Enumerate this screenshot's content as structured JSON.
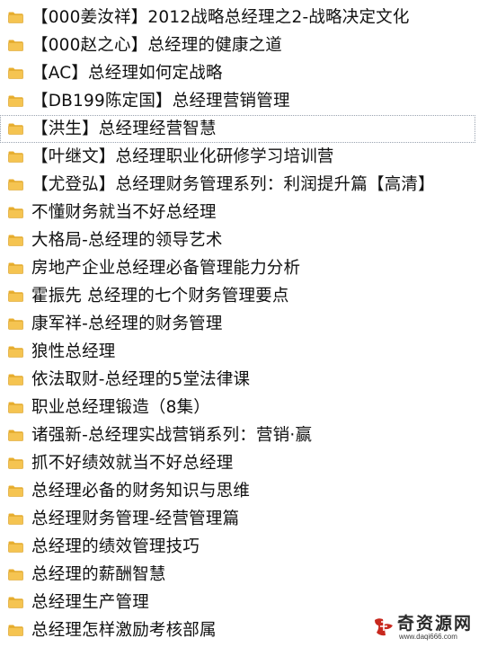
{
  "folders": [
    {
      "label": "【000姜汝祥】2012战略总经理之2-战略决定文化",
      "selected": false
    },
    {
      "label": "【000赵之心】总经理的健康之道",
      "selected": false
    },
    {
      "label": "【AC】总经理如何定战略",
      "selected": false
    },
    {
      "label": "【DB199陈定国】总经理营销管理",
      "selected": false
    },
    {
      "label": "【洪生】总经理经营智慧",
      "selected": true
    },
    {
      "label": "【叶继文】总经理职业化研修学习培训营",
      "selected": false
    },
    {
      "label": "【尤登弘】总经理财务管理系列：利润提升篇【高清】",
      "selected": false
    },
    {
      "label": "不懂财务就当不好总经理",
      "selected": false
    },
    {
      "label": "大格局-总经理的领导艺术",
      "selected": false
    },
    {
      "label": "房地产企业总经理必备管理能力分析",
      "selected": false
    },
    {
      "label": "霍振先 总经理的七个财务管理要点",
      "selected": false
    },
    {
      "label": "康军祥-总经理的财务管理",
      "selected": false
    },
    {
      "label": "狼性总经理",
      "selected": false
    },
    {
      "label": "依法取财-总经理的5堂法律课",
      "selected": false
    },
    {
      "label": "职业总经理锻造（8集）",
      "selected": false
    },
    {
      "label": "诸强新-总经理实战营销系列：营销·赢",
      "selected": false
    },
    {
      "label": "抓不好绩效就当不好总经理",
      "selected": false
    },
    {
      "label": "总经理必备的财务知识与思维",
      "selected": false
    },
    {
      "label": "总经理财务管理-经营管理篇",
      "selected": false
    },
    {
      "label": "总经理的绩效管理技巧",
      "selected": false
    },
    {
      "label": "总经理的薪酬智慧",
      "selected": false
    },
    {
      "label": "总经理生产管理",
      "selected": false
    },
    {
      "label": "总经理怎样激励考核部属",
      "selected": false
    }
  ],
  "icon": {
    "name": "folder-icon",
    "body_color": "#F5C451",
    "tab_color": "#E8AE2E",
    "edge_color": "#D79B1C"
  },
  "watermark": {
    "title": "奇资源网",
    "url": "www.daqi666.com",
    "logo_color": "#C8281E"
  }
}
